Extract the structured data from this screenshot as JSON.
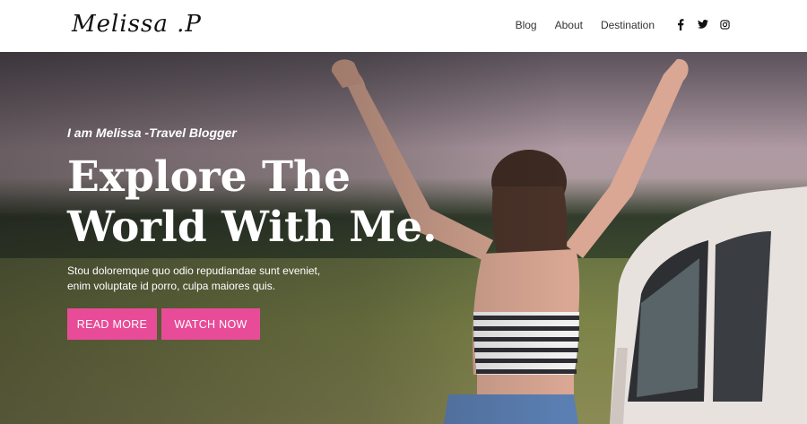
{
  "header": {
    "logo": "Melissa .P",
    "nav": [
      {
        "label": "Blog"
      },
      {
        "label": "About"
      },
      {
        "label": "Destination"
      }
    ],
    "social": [
      "facebook-icon",
      "twitter-icon",
      "instagram-icon"
    ]
  },
  "hero": {
    "tagline": "I am Melissa -Travel Blogger",
    "headline_line1": "Explore The",
    "headline_line2": "World With Me.",
    "description_line1": "Stou doloremque quo odio repudiandae sunt eveniet,",
    "description_line2": "enim voluptate id porro, culpa maiores quis.",
    "buttons": {
      "read_more": "READ MORE",
      "watch_now": "WATCH NOW"
    }
  },
  "colors": {
    "accent": "#e84c98",
    "text_dark": "#333333",
    "text_light": "#ffffff"
  }
}
